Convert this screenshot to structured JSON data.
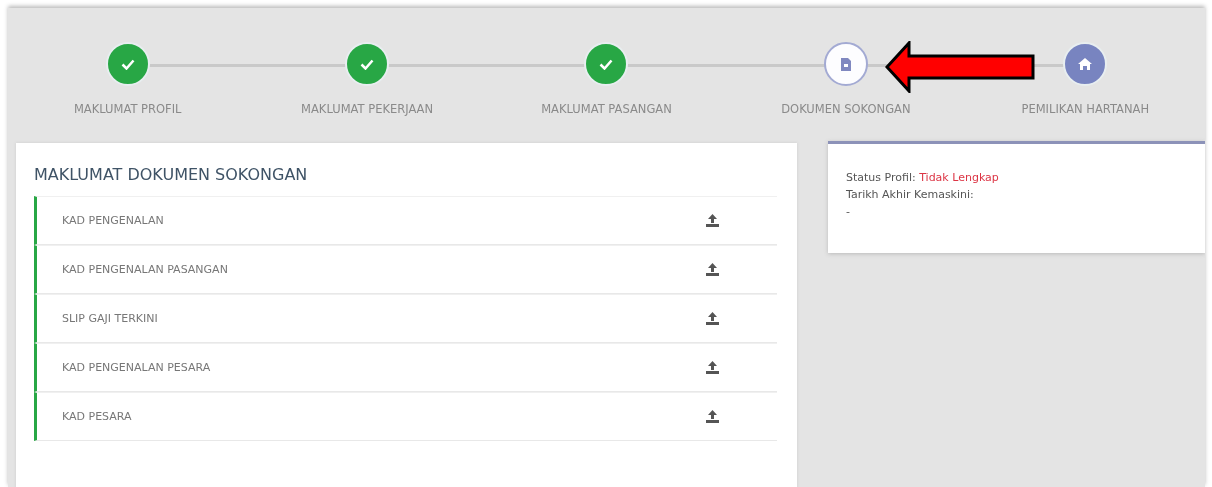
{
  "steps": [
    {
      "label": "MAKLUMAT PROFIL",
      "kind": "done"
    },
    {
      "label": "MAKLUMAT PEKERJAAN",
      "kind": "done"
    },
    {
      "label": "MAKLUMAT PASANGAN",
      "kind": "done"
    },
    {
      "label": "DOKUMEN SOKONGAN",
      "kind": "current"
    },
    {
      "label": "PEMILIKAN HARTANAH",
      "kind": "pending"
    }
  ],
  "documents": {
    "title": "MAKLUMAT DOKUMEN SOKONGAN",
    "items": [
      "KAD PENGENALAN",
      "KAD PENGENALAN PASANGAN",
      "SLIP GAJI TERKINI",
      "KAD PENGENALAN PESARA",
      "KAD PESARA"
    ]
  },
  "status": {
    "profile_label": "Status Profil:",
    "profile_value": "Tidak Lengkap",
    "updated_label": "Tarikh Akhir Kemaskini:",
    "updated_value": "-"
  }
}
